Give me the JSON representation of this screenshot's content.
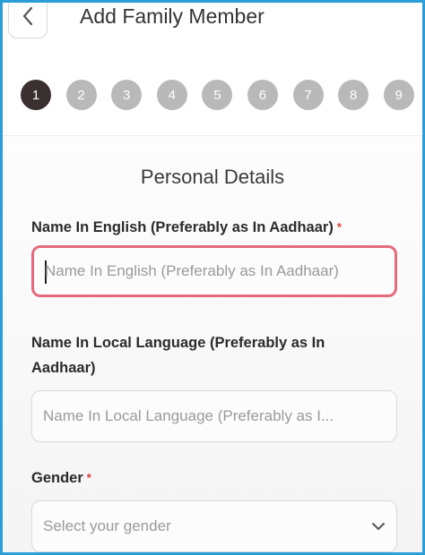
{
  "header": {
    "title": "Add Family Member",
    "back_icon": "chevron-left-icon",
    "steps": [
      "1",
      "2",
      "3",
      "4",
      "5",
      "6",
      "7",
      "8",
      "9"
    ],
    "active_step": "1"
  },
  "form": {
    "section_title": "Personal Details",
    "name_english": {
      "label": "Name In English (Preferably as In Aadhaar)",
      "required_mark": "*",
      "placeholder": "Name In English (Preferably as In Aadhaar)",
      "value": ""
    },
    "name_local": {
      "label_line1": "Name In Local Language (Preferably as In",
      "label_line2": "Aadhaar)",
      "placeholder": "Name In Local Language (Preferably as I...",
      "value": ""
    },
    "gender": {
      "label": "Gender",
      "required_mark": "*",
      "placeholder": "Select your gender",
      "icon": "chevron-down-icon"
    }
  },
  "colors": {
    "frame_border": "#2a9ed8",
    "active_step": "#3a3030",
    "inactive_step": "#b9b9b9",
    "focus_border": "#e36b7c",
    "required": "#e03b3b"
  }
}
